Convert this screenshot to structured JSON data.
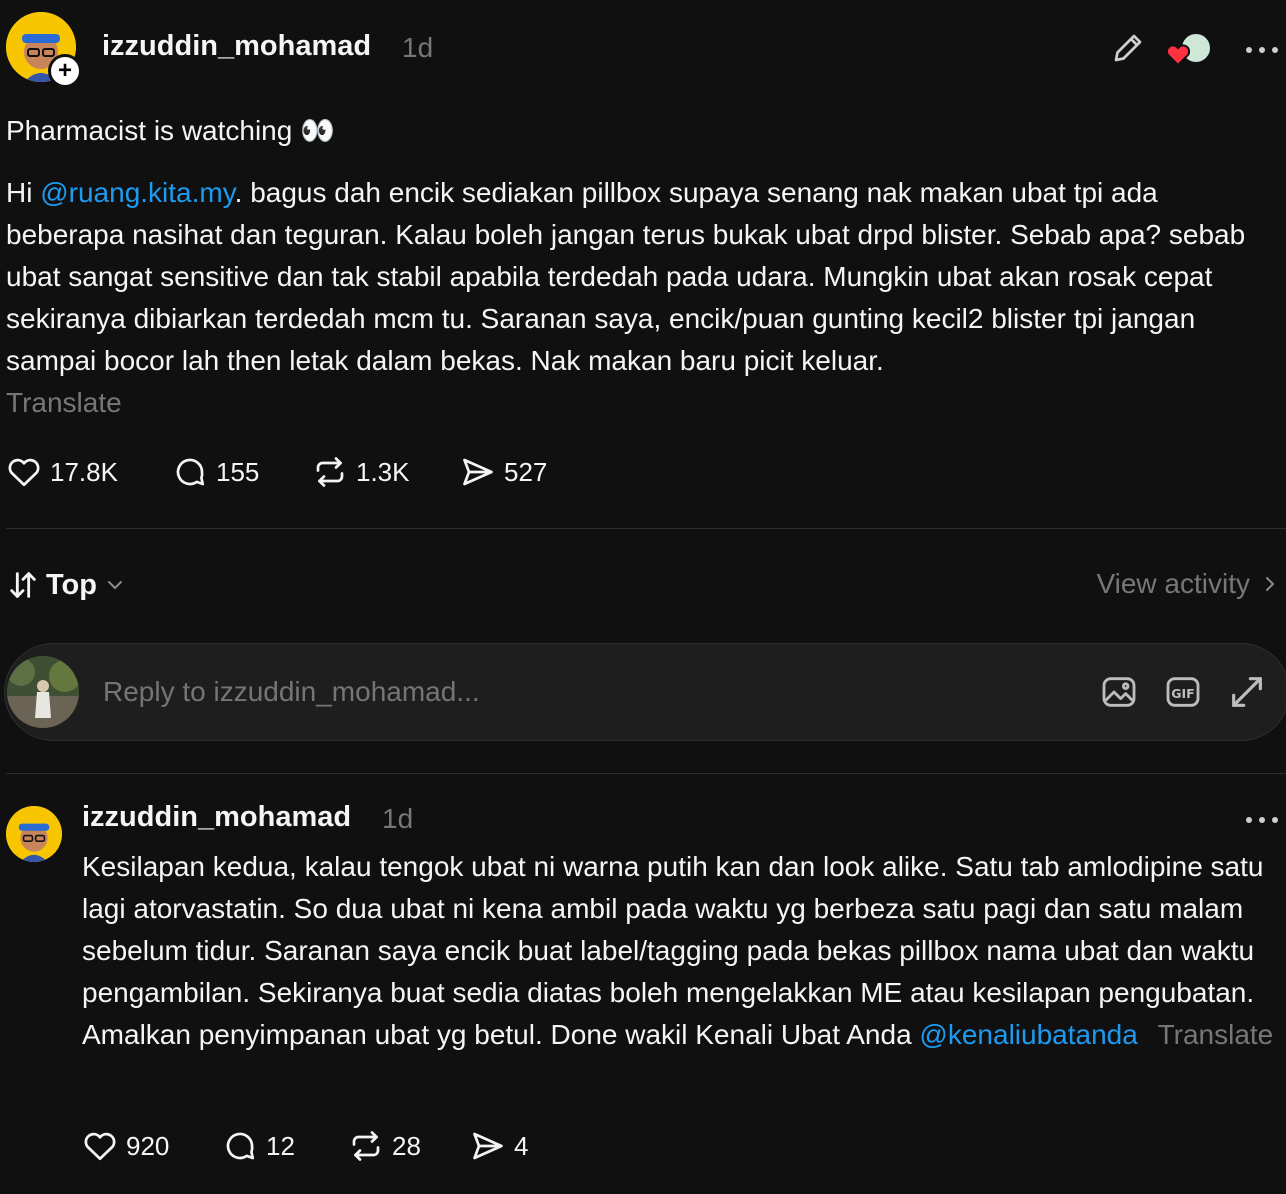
{
  "post": {
    "username": "izzuddin_mohamad",
    "time": "1d",
    "title": "Pharmacist is watching 👀",
    "body_prefix": "Hi ",
    "mention": "@ruang.kita.my",
    "body_rest": ". bagus dah encik sediakan pillbox supaya senang nak makan ubat tpi ada beberapa nasihat dan teguran. Kalau boleh jangan terus bukak ubat drpd blister. Sebab apa? sebab ubat sangat sensitive dan tak stabil apabila terdedah pada udara. Mungkin ubat akan rosak cepat sekiranya dibiarkan terdedah mcm tu. Saranan saya, encik/puan gunting kecil2 blister tpi jangan sampai bocor lah then letak dalam bekas. Nak makan baru picit keluar.",
    "translate": "Translate",
    "likes": "17.8K",
    "comments": "155",
    "reposts": "1.3K",
    "shares": "527"
  },
  "sort": {
    "label": "Top",
    "view_activity": "View activity"
  },
  "reply_box": {
    "placeholder": "Reply to izzuddin_mohamad..."
  },
  "reply": {
    "username": "izzuddin_mohamad",
    "time": "1d",
    "body": "Kesilapan kedua, kalau tengok ubat ni warna putih kan dan look alike. Satu tab amlodipine satu lagi atorvastatin. So dua ubat ni kena ambil pada waktu yg berbeza satu pagi dan satu malam sebelum tidur. Saranan saya encik buat label/tagging pada bekas pillbox nama ubat dan waktu pengambilan. Sekiranya buat sedia diatas boleh mengelakkan ME atau kesilapan pengubatan. Amalkan penyimpanan ubat yg betul. Done wakil Kenali Ubat Anda ",
    "mention": "@kenaliubatanda",
    "translate": "Translate",
    "likes": "920",
    "comments": "12",
    "reposts": "28",
    "shares": "4"
  },
  "colors": {
    "background": "#101010",
    "text": "#f3f5f7",
    "muted": "#777777",
    "link": "#1d9bf0",
    "heart": "#ff3040"
  }
}
